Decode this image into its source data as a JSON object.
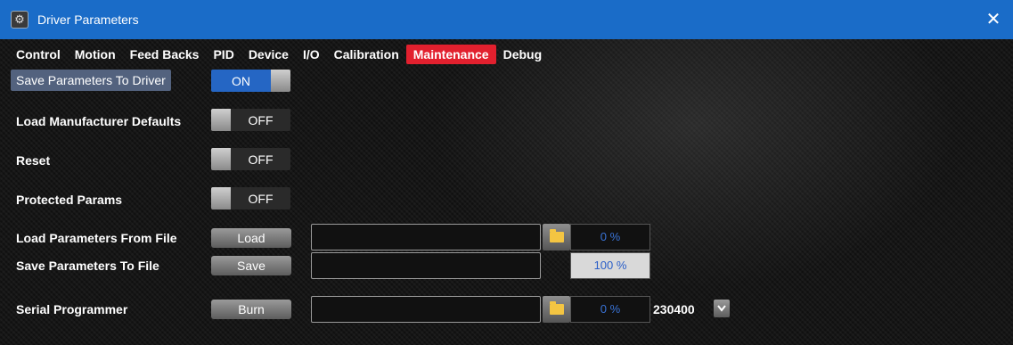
{
  "window": {
    "title": "Driver Parameters",
    "close_symbol": "✕"
  },
  "tabs": [
    {
      "label": "Control"
    },
    {
      "label": "Motion"
    },
    {
      "label": "Feed Backs"
    },
    {
      "label": "PID"
    },
    {
      "label": "Device"
    },
    {
      "label": "I/O"
    },
    {
      "label": "Calibration"
    },
    {
      "label": "Maintenance",
      "active": true
    },
    {
      "label": "Debug"
    }
  ],
  "rows": {
    "save_to_driver": {
      "label": "Save Parameters To Driver",
      "state": "ON"
    },
    "load_defaults": {
      "label": "Load Manufacturer Defaults",
      "state": "OFF"
    },
    "reset": {
      "label": "Reset",
      "state": "OFF"
    },
    "protected": {
      "label": "Protected Params",
      "state": "OFF"
    },
    "load_file": {
      "label": "Load Parameters From File",
      "button": "Load",
      "path": "",
      "progress_text": "0 %",
      "progress": 0
    },
    "save_file": {
      "label": "Save Parameters To File",
      "button": "Save",
      "path": "",
      "progress_text": "100 %",
      "progress": 1
    },
    "serial": {
      "label": "Serial Programmer",
      "button": "Burn",
      "path": "",
      "progress_text": "0 %",
      "progress": 0,
      "baud": "230400"
    }
  },
  "colors": {
    "titlebar": "#1a6cc8",
    "active_tab": "#e2202e",
    "toggle_on": "#2566c4",
    "highlight_label": "#53627e"
  },
  "icons": [
    "app-icon",
    "close-icon",
    "folder-icon",
    "chevron-down-icon"
  ]
}
